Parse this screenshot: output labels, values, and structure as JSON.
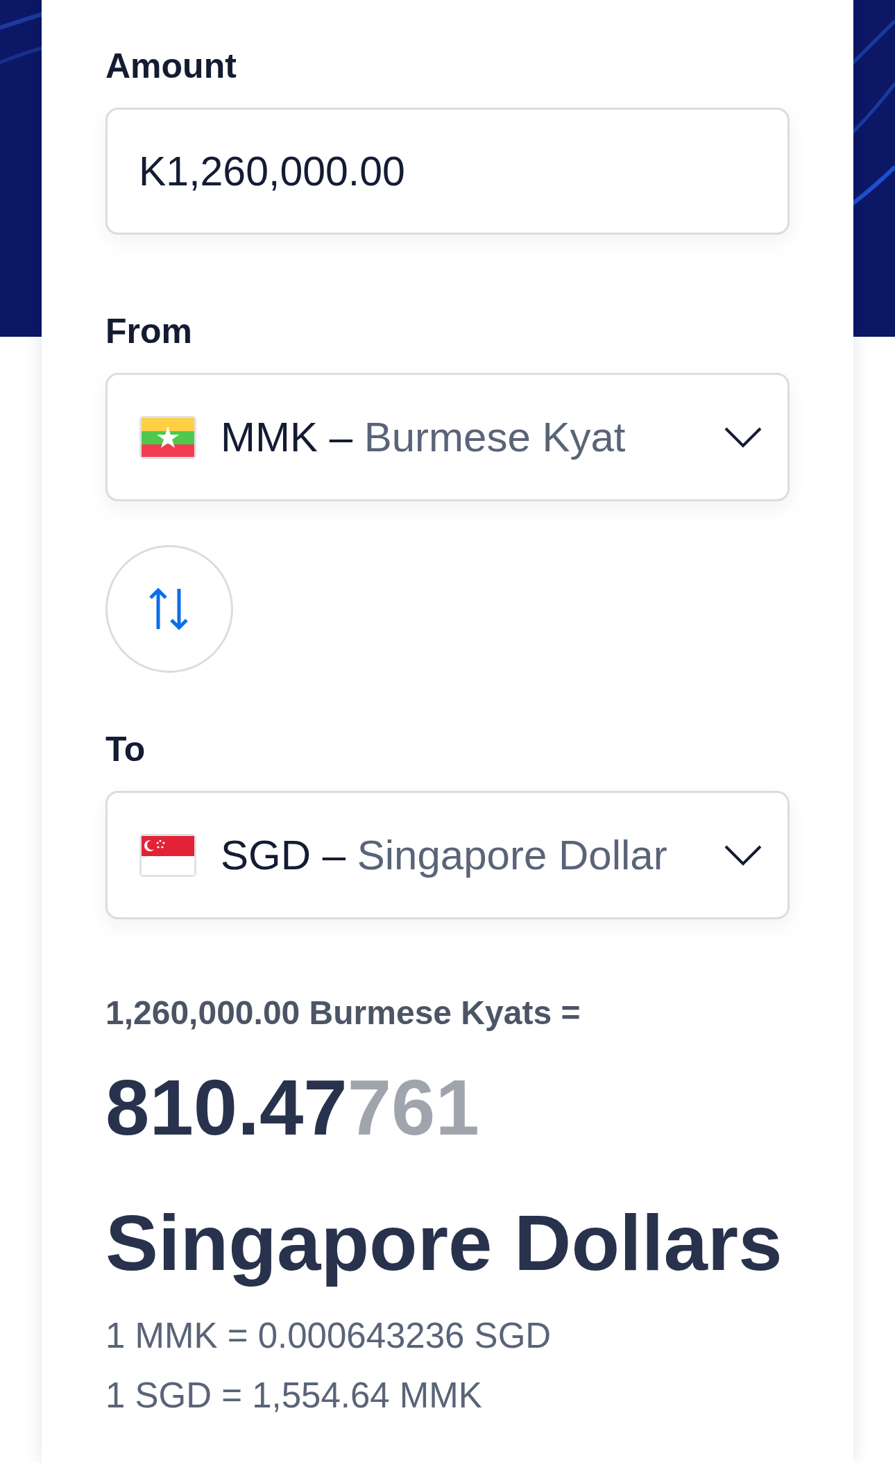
{
  "amount": {
    "label": "Amount",
    "value": "K1,260,000.00"
  },
  "from": {
    "label": "From",
    "code": "MMK",
    "separator": "–",
    "name": "Burmese Kyat",
    "flag": {
      "kind": "mm"
    }
  },
  "swap": {
    "kind": "swap"
  },
  "to": {
    "label": "To",
    "code": "SGD",
    "separator": "–",
    "name": "Singapore Dollar",
    "flag": {
      "kind": "sg"
    }
  },
  "result": {
    "source": "1,260,000.00 Burmese Kyats =",
    "amount_main": "810.47",
    "amount_dim": "761",
    "unit": "Singapore Dollars"
  },
  "rates": [
    "1 MMK = 0.000643236 SGD",
    "1 SGD = 1,554.64 MMK"
  ]
}
